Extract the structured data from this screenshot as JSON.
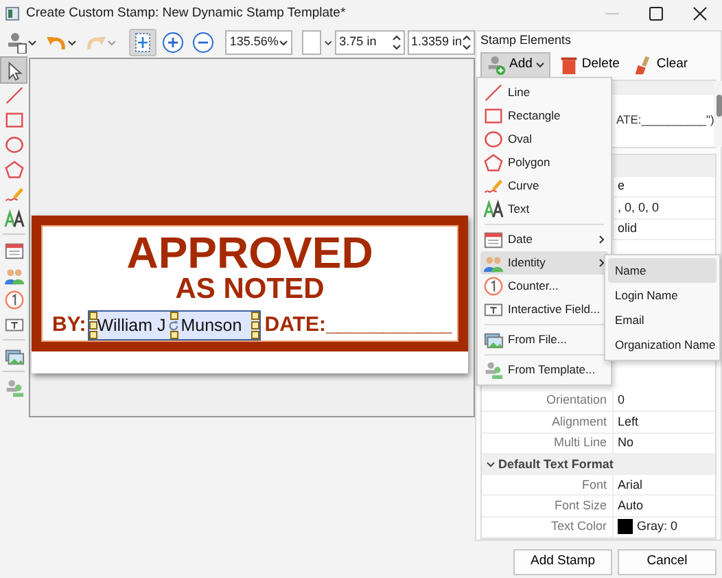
{
  "window": {
    "title": "Create Custom Stamp: New Dynamic Stamp Template*"
  },
  "toolbar": {
    "items": [
      {
        "kind": "stamp",
        "disabled": false,
        "selected": false,
        "caret": true
      },
      {
        "kind": "undo",
        "disabled": false,
        "selected": false,
        "caret": true
      },
      {
        "kind": "redo",
        "disabled": true,
        "selected": false,
        "caret": true
      },
      {
        "kind": "fit",
        "disabled": false,
        "selected": true,
        "caret": false
      },
      {
        "kind": "zoom-in",
        "disabled": false,
        "selected": false,
        "caret": false
      },
      {
        "kind": "zoom-out",
        "disabled": false,
        "selected": false,
        "caret": false
      }
    ],
    "zoom": "135.56%",
    "width": "3.75 in",
    "height": "1.3359 in"
  },
  "tools": [
    {
      "kind": "pointer",
      "selected": true
    },
    {
      "kind": "line",
      "selected": false
    },
    {
      "kind": "rectangle",
      "selected": false
    },
    {
      "kind": "oval",
      "selected": false
    },
    {
      "kind": "polygon",
      "selected": false
    },
    {
      "kind": "curve",
      "selected": false
    },
    {
      "kind": "text",
      "selected": false
    },
    {
      "kind": "separator"
    },
    {
      "kind": "date",
      "selected": false
    },
    {
      "kind": "identity",
      "selected": false
    },
    {
      "kind": "counter",
      "selected": false
    },
    {
      "kind": "field",
      "selected": false
    },
    {
      "kind": "separator"
    },
    {
      "kind": "file",
      "selected": false
    },
    {
      "kind": "separator"
    },
    {
      "kind": "template",
      "selected": false
    }
  ],
  "stamp": {
    "title": "APPROVED",
    "subtitle": "AS NOTED",
    "by_label": "BY:",
    "by_value": [
      "William J",
      "Munson"
    ],
    "date_label": "DATE:___________"
  },
  "stamp_elements": {
    "title": "Stamp Elements",
    "buttons": [
      {
        "kind": "add",
        "label": "Add",
        "selected": true
      },
      {
        "kind": "delete",
        "label": "Delete",
        "selected": false
      },
      {
        "kind": "clear",
        "label": "Clear",
        "selected": false
      }
    ],
    "list_text": "ATE:__________\")"
  },
  "properties": {
    "partial_values": [
      "e",
      ", 0, 0, 0",
      "olid"
    ],
    "rows": [
      {
        "kind": "row",
        "label": "Orientation",
        "value": "0"
      },
      {
        "kind": "row",
        "label": "Alignment",
        "value": "Left"
      },
      {
        "kind": "row",
        "label": "Multi Line",
        "value": "No"
      },
      {
        "kind": "group",
        "label": "Default Text Format",
        "expanded": true
      },
      {
        "kind": "row",
        "label": "Font",
        "value": "Arial"
      },
      {
        "kind": "row",
        "label": "Font Size",
        "value": "Auto"
      },
      {
        "kind": "color",
        "label": "Text Color",
        "value": "Gray: 0",
        "color": "#000000"
      }
    ]
  },
  "add_menu": {
    "items": [
      {
        "kind": "line",
        "label": "Line",
        "submenu": false,
        "selected": false
      },
      {
        "kind": "rectangle",
        "label": "Rectangle",
        "submenu": false,
        "selected": false
      },
      {
        "kind": "oval",
        "label": "Oval",
        "submenu": false,
        "selected": false
      },
      {
        "kind": "polygon",
        "label": "Polygon",
        "submenu": false,
        "selected": false
      },
      {
        "kind": "curve",
        "label": "Curve",
        "submenu": false,
        "selected": false
      },
      {
        "kind": "text",
        "label": "Text",
        "submenu": false,
        "selected": false
      },
      {
        "kind": "separator"
      },
      {
        "kind": "date",
        "label": "Date",
        "submenu": true,
        "selected": false
      },
      {
        "kind": "identity",
        "label": "Identity",
        "submenu": true,
        "selected": true
      },
      {
        "kind": "counter",
        "label": "Counter...",
        "submenu": false,
        "selected": false
      },
      {
        "kind": "field",
        "label": "Interactive Field...",
        "submenu": false,
        "selected": false
      },
      {
        "kind": "separator"
      },
      {
        "kind": "file",
        "label": "From File...",
        "submenu": false,
        "selected": false
      },
      {
        "kind": "separator"
      },
      {
        "kind": "template",
        "label": "From Template...",
        "submenu": false,
        "selected": false
      }
    ],
    "submenu": [
      {
        "label": "Name",
        "selected": true
      },
      {
        "label": "Login Name",
        "selected": false
      },
      {
        "label": "Email",
        "selected": false
      },
      {
        "label": "Organization Name",
        "selected": false
      }
    ]
  },
  "buttons": [
    "Add Stamp",
    "Cancel"
  ]
}
